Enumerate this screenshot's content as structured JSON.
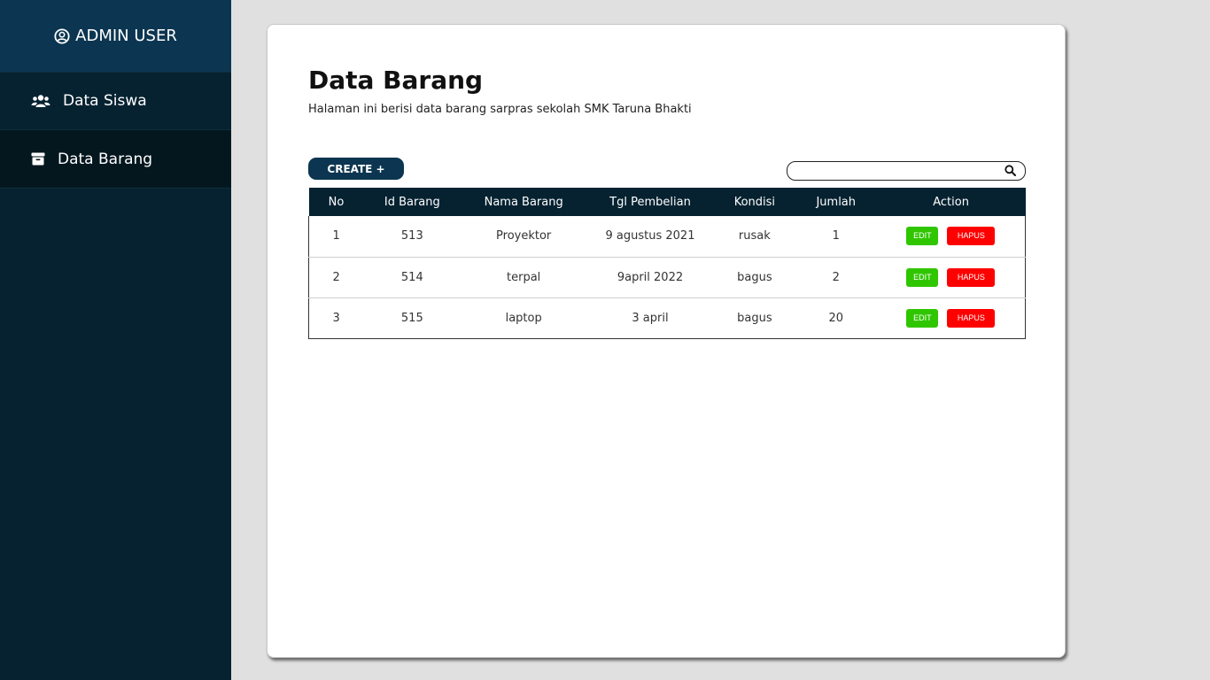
{
  "sidebar": {
    "user_label": "ADMIN USER",
    "user_icon": "user-circle-icon",
    "items": [
      {
        "label": "Data Siswa",
        "icon": "users-icon"
      },
      {
        "label": "Data Barang",
        "icon": "box-icon"
      }
    ],
    "colors": {
      "background": "#062231",
      "header": "#0b3550",
      "active": "#04171f"
    }
  },
  "main": {
    "title": "Data Barang",
    "subtitle": "Halaman ini berisi data barang sarpras sekolah SMK Taruna Bhakti",
    "create_label": "CREATE +",
    "search": {
      "placeholder": "",
      "value": "",
      "icon": "search-icon"
    },
    "table": {
      "headers": [
        "No",
        "Id Barang",
        "Nama Barang",
        "Tgl Pembelian",
        "Kondisi",
        "Jumlah",
        "Action"
      ],
      "rows": [
        {
          "no": "1",
          "id": "513",
          "nama": "Proyektor",
          "tgl": "9 agustus 2021",
          "kondisi": "rusak",
          "jumlah": "1"
        },
        {
          "no": "2",
          "id": "514",
          "nama": "terpal",
          "tgl": "9april 2022",
          "kondisi": "bagus",
          "jumlah": "2"
        },
        {
          "no": "3",
          "id": "515",
          "nama": "laptop",
          "tgl": "3 april",
          "kondisi": "bagus",
          "jumlah": "20"
        }
      ],
      "edit_label": "EDIT",
      "hapus_label": "HAPUS"
    },
    "colors": {
      "edit": "#2fc600",
      "hapus": "#ff0000",
      "header": "#062231"
    }
  }
}
